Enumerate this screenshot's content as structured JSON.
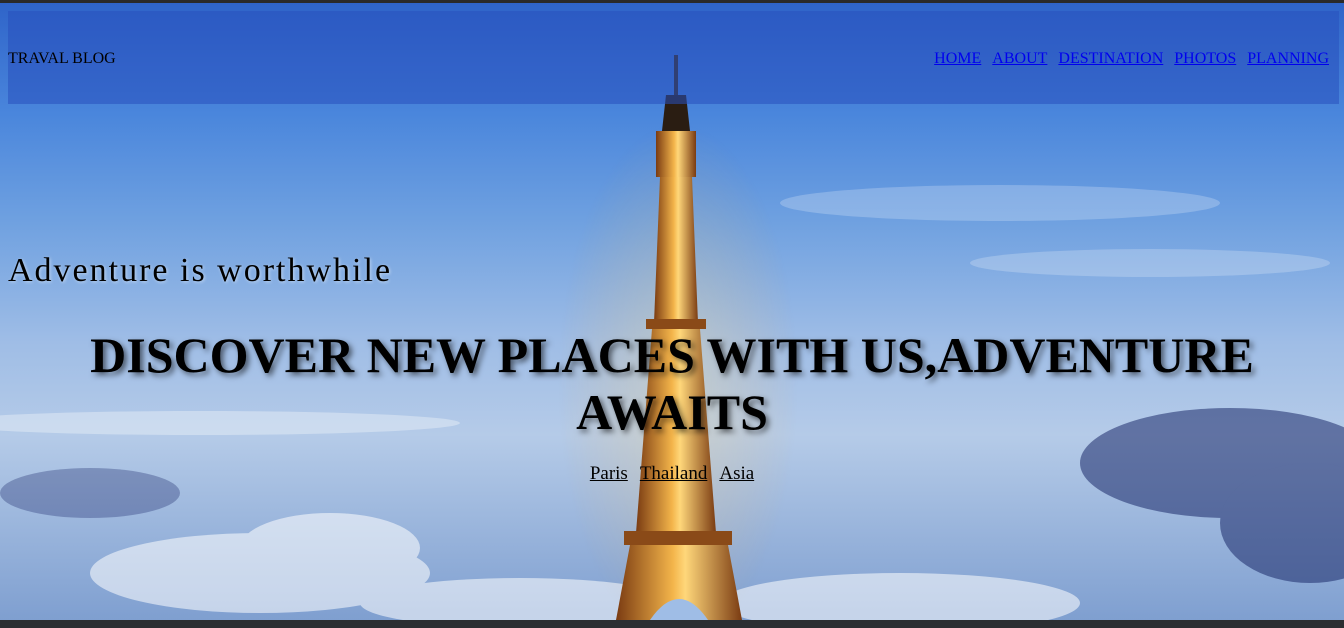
{
  "nav": {
    "brand": "TRAVAL BLOG",
    "links": [
      "HOME",
      "ABOUT",
      "DESTINATION",
      "PHOTOS",
      "PLANNING"
    ]
  },
  "hero": {
    "tagline": "Adventure is worthwhile",
    "headline": "DISCOVER NEW PLACES WITH US,ADVENTURE AWAITS",
    "destinations": [
      "Paris",
      "Thailand",
      "Asia"
    ]
  },
  "colors": {
    "nav_link": "#0000ee",
    "sky": "#4a86dc",
    "footer_bar": "#2b2d31"
  }
}
